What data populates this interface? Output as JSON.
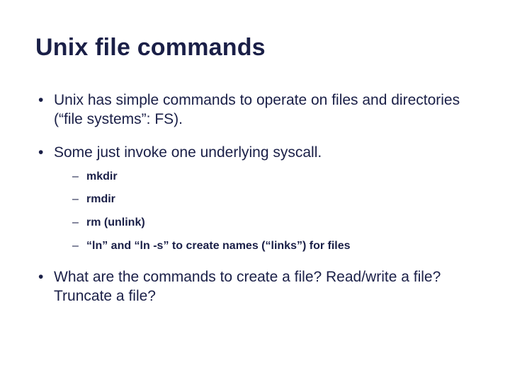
{
  "title": "Unix file commands",
  "bullets": {
    "b1": "Unix has simple commands to operate on files and directories (“file systems”: FS).",
    "b2": "Some just invoke one underlying syscall.",
    "b3": "What are the commands to create a file?  Read/write a file?  Truncate a file?"
  },
  "subbullets": {
    "s1": "mkdir",
    "s2": "rmdir",
    "s3": "rm (unlink)",
    "s4": "“ln” and “ln -s” to create names (“links”) for files"
  }
}
